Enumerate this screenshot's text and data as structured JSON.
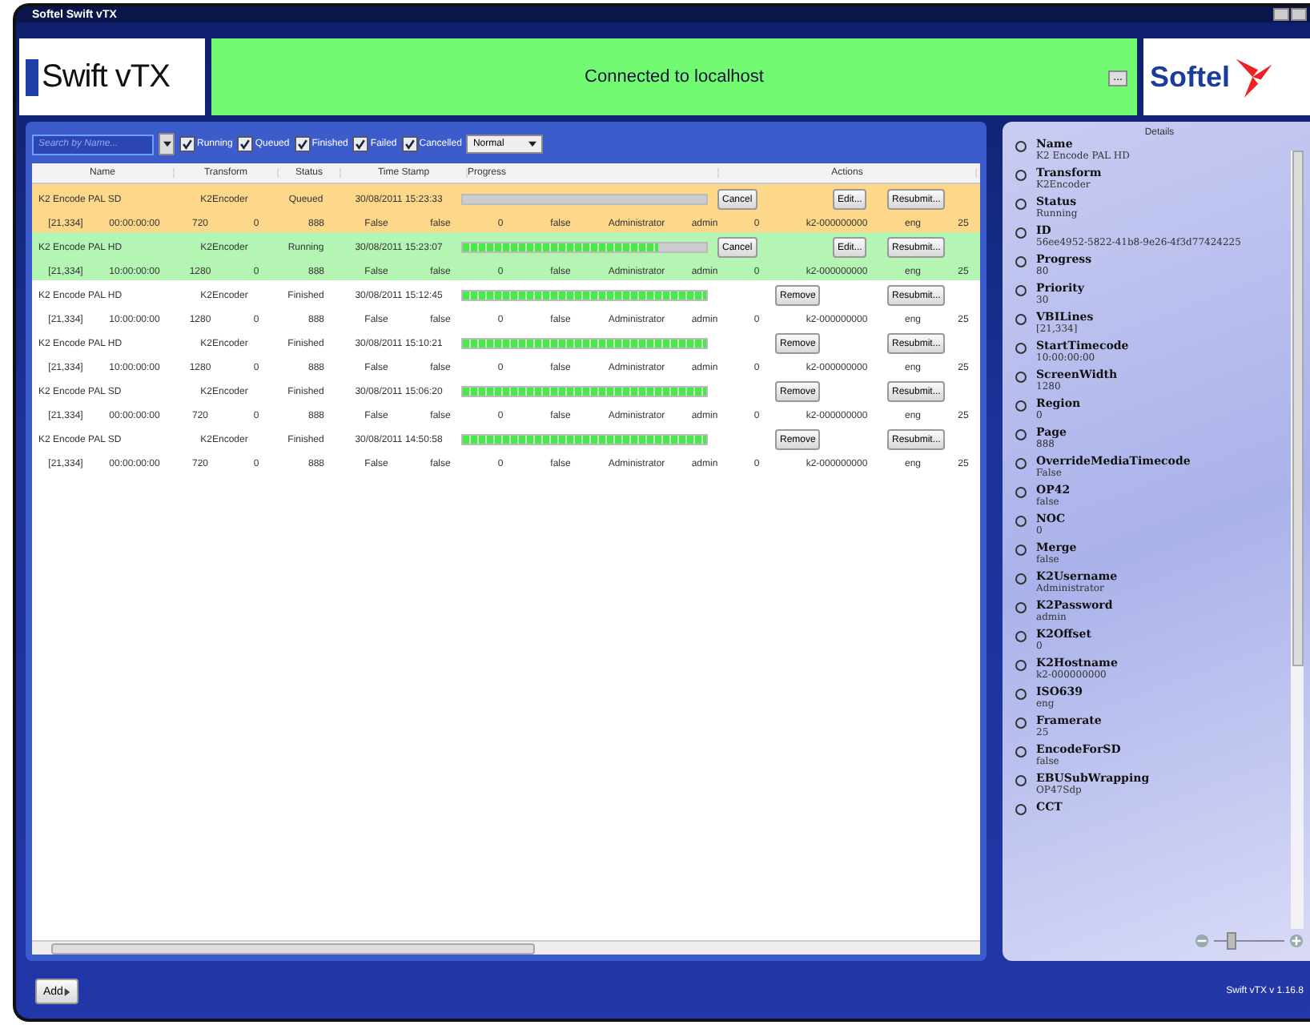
{
  "window": {
    "title": "Softel Swift vTX"
  },
  "header": {
    "logo_text": "Swift vTX",
    "status": "Connected to localhost",
    "more_button": "...",
    "brand": "Softel"
  },
  "toolbar": {
    "search": {
      "placeholder": "Search by Name..."
    },
    "filters": [
      {
        "label": "Running",
        "checked": true
      },
      {
        "label": "Queued",
        "checked": true
      },
      {
        "label": "Finished",
        "checked": true
      },
      {
        "label": "Failed",
        "checked": true
      },
      {
        "label": "Cancelled",
        "checked": true
      }
    ],
    "priority": "Normal"
  },
  "table": {
    "columns": [
      "Name",
      "Transform",
      "Status",
      "Time Stamp",
      "Progress",
      "Actions"
    ],
    "rows": [
      {
        "kind": "queued",
        "name": "K2 Encode PAL SD",
        "transform": "K2Encoder",
        "status": "Queued",
        "timestamp": "30/08/2011 15:23:33",
        "actions": [
          {
            "kind": "cancel",
            "label": "Cancel"
          },
          {
            "kind": "edit",
            "label": "Edit..."
          },
          {
            "kind": "resubmit",
            "label": "Resubmit..."
          }
        ],
        "details": [
          "[21,334]",
          "00:00:00:00",
          "720",
          "0",
          "888",
          "False",
          "false",
          "0",
          "false",
          "Administrator",
          "admin",
          "0",
          "k2-000000000",
          "eng",
          "25"
        ]
      },
      {
        "kind": "running",
        "name": "K2 Encode PAL HD",
        "transform": "K2Encoder",
        "status": "Running",
        "timestamp": "30/08/2011 15:23:07",
        "level": 0.8,
        "actions": [
          {
            "kind": "cancel",
            "label": "Cancel"
          },
          {
            "kind": "edit",
            "label": "Edit..."
          },
          {
            "kind": "resubmit",
            "label": "Resubmit..."
          }
        ],
        "details": [
          "[21,334]",
          "10:00:00:00",
          "1280",
          "0",
          "888",
          "False",
          "false",
          "0",
          "false",
          "Administrator",
          "admin",
          "0",
          "k2-000000000",
          "eng",
          "25"
        ]
      },
      {
        "kind": "finished",
        "name": "K2 Encode PAL HD",
        "transform": "K2Encoder",
        "status": "Finished",
        "timestamp": "30/08/2011 15:12:45",
        "level": 1,
        "actions": [
          {
            "kind": "remove",
            "label": "Remove"
          },
          {
            "kind": "resubmit",
            "label": "Resubmit..."
          }
        ],
        "details": [
          "[21,334]",
          "10:00:00:00",
          "1280",
          "0",
          "888",
          "False",
          "false",
          "0",
          "false",
          "Administrator",
          "admin",
          "0",
          "k2-000000000",
          "eng",
          "25"
        ]
      },
      {
        "kind": "finished",
        "name": "K2 Encode PAL HD",
        "transform": "K2Encoder",
        "status": "Finished",
        "timestamp": "30/08/2011 15:10:21",
        "level": 1,
        "actions": [
          {
            "kind": "remove",
            "label": "Remove"
          },
          {
            "kind": "resubmit",
            "label": "Resubmit..."
          }
        ],
        "details": [
          "[21,334]",
          "10:00:00:00",
          "1280",
          "0",
          "888",
          "False",
          "false",
          "0",
          "false",
          "Administrator",
          "admin",
          "0",
          "k2-000000000",
          "eng",
          "25"
        ]
      },
      {
        "kind": "finished",
        "name": "K2 Encode PAL SD",
        "transform": "K2Encoder",
        "status": "Finished",
        "timestamp": "30/08/2011 15:06:20",
        "level": 1,
        "actions": [
          {
            "kind": "remove",
            "label": "Remove"
          },
          {
            "kind": "resubmit",
            "label": "Resubmit..."
          }
        ],
        "details": [
          "[21,334]",
          "00:00:00:00",
          "720",
          "0",
          "888",
          "False",
          "false",
          "0",
          "false",
          "Administrator",
          "admin",
          "0",
          "k2-000000000",
          "eng",
          "25"
        ]
      },
      {
        "kind": "finished",
        "name": "K2 Encode PAL SD",
        "transform": "K2Encoder",
        "status": "Finished",
        "timestamp": "30/08/2011 14:50:58",
        "level": 1,
        "actions": [
          {
            "kind": "remove",
            "label": "Remove"
          },
          {
            "kind": "resubmit",
            "label": "Resubmit..."
          }
        ],
        "details": [
          "[21,334]",
          "00:00:00:00",
          "720",
          "0",
          "888",
          "False",
          "false",
          "0",
          "false",
          "Administrator",
          "admin",
          "0",
          "k2-000000000",
          "eng",
          "25"
        ]
      }
    ]
  },
  "details": {
    "title": "Details",
    "items": [
      {
        "label": "Name",
        "value": "K2 Encode PAL HD"
      },
      {
        "label": "Transform",
        "value": "K2Encoder"
      },
      {
        "label": "Status",
        "value": "Running"
      },
      {
        "label": "ID",
        "value": "56ee4952-5822-41b8-9e26-4f3d77424225"
      },
      {
        "label": "Progress",
        "value": "80"
      },
      {
        "label": "Priority",
        "value": "30"
      },
      {
        "label": "VBILines",
        "value": "[21,334]"
      },
      {
        "label": "StartTimecode",
        "value": "10:00:00:00"
      },
      {
        "label": "ScreenWidth",
        "value": "1280"
      },
      {
        "label": "Region",
        "value": "0"
      },
      {
        "label": "Page",
        "value": "888"
      },
      {
        "label": "OverrideMediaTimecode",
        "value": "False"
      },
      {
        "label": "OP42",
        "value": "false"
      },
      {
        "label": "NOC",
        "value": "0"
      },
      {
        "label": "Merge",
        "value": "false"
      },
      {
        "label": "K2Username",
        "value": "Administrator"
      },
      {
        "label": "K2Password",
        "value": "admin"
      },
      {
        "label": "K2Offset",
        "value": "0"
      },
      {
        "label": "K2Hostname",
        "value": "k2-000000000"
      },
      {
        "label": "ISO639",
        "value": "eng"
      },
      {
        "label": "Framerate",
        "value": "25"
      },
      {
        "label": "EncodeForSD",
        "value": "false"
      },
      {
        "label": "EBUSubWrapping",
        "value": "OP47Sdp"
      },
      {
        "label": "CCT"
      }
    ],
    "zoom": {
      "level": 0.2
    }
  },
  "footer": {
    "add_button": "Add",
    "version": "Swift vTX v 1.16.8"
  }
}
